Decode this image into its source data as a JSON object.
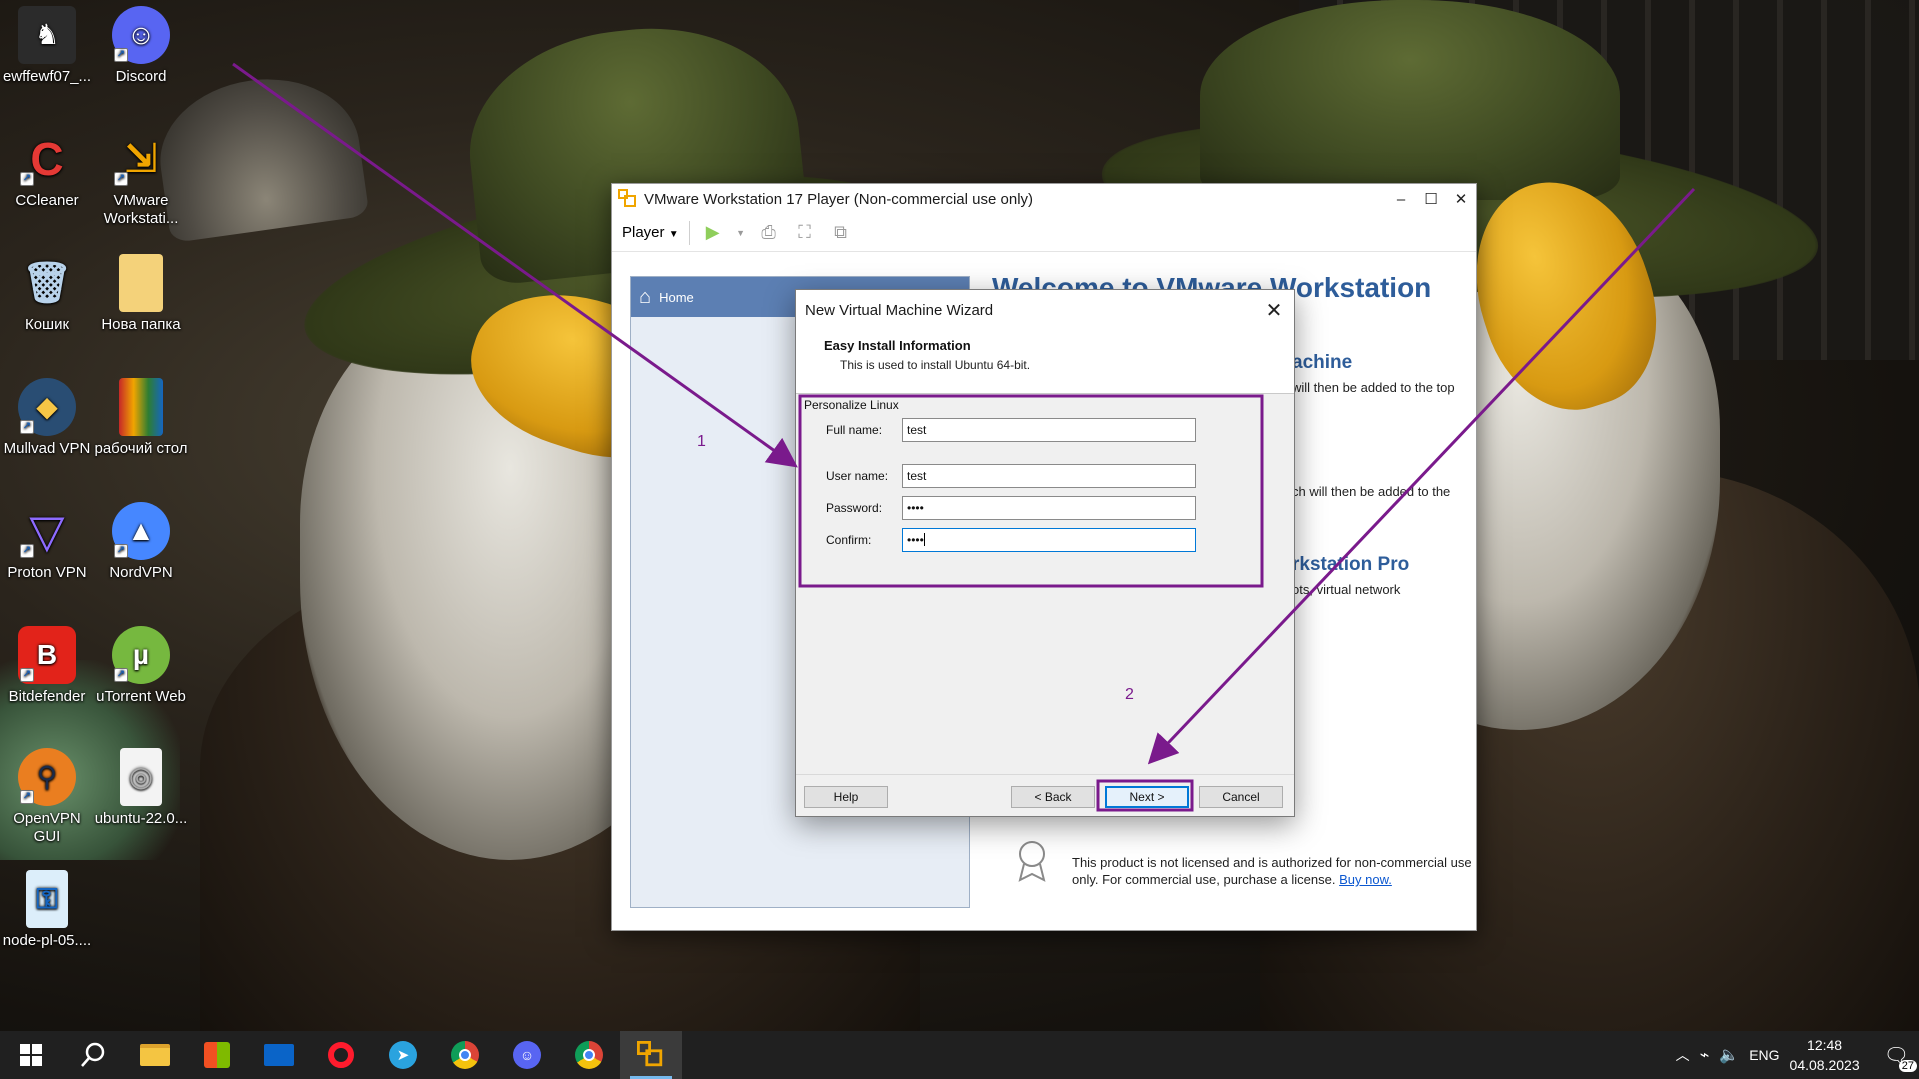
{
  "desktop": {
    "icons": [
      {
        "label": "ewffewf07_...",
        "color": "#2b2b2b"
      },
      {
        "label": "Discord",
        "color": "#5865f2"
      },
      {
        "label": "CCleaner",
        "color": "#c62828"
      },
      {
        "label": "VMware Workstati...",
        "color": "#f0a500"
      },
      {
        "label": "Кошик",
        "color": "#7ba7c9"
      },
      {
        "label": "Нова папка",
        "color": "#f4d27a"
      },
      {
        "label": "Mullvad VPN",
        "color": "#294d73"
      },
      {
        "label": "рабочий стол",
        "color": "#d98c2b"
      },
      {
        "label": "Proton VPN",
        "color": "#6d4aff"
      },
      {
        "label": "NordVPN",
        "color": "#4687ff"
      },
      {
        "label": "Bitdefender",
        "color": "#e2231a"
      },
      {
        "label": "uTorrent Web",
        "color": "#76b83f"
      },
      {
        "label": "OpenVPN GUI",
        "color": "#ea7e20"
      },
      {
        "label": "ubuntu-22.0...",
        "color": "#e8e8e8"
      },
      {
        "label": "node-pl-05....",
        "color": "#6fb5e8"
      }
    ]
  },
  "vmware": {
    "title": "VMware Workstation 17 Player (Non-commercial use only)",
    "menu_player": "Player",
    "sidebar_home": "Home",
    "home": {
      "title_visible": "Welcome to VMware Workstation",
      "h2_a": "achine",
      "text_a": "will then be added to the top",
      "text_b": "ch will then be added to the",
      "h2_b": "rkstation Pro",
      "text_c": "ots, virtual network",
      "license_text": "This product is not licensed and is authorized for non-commercial use only. For commercial use, purchase a license.",
      "license_link": "Buy now."
    }
  },
  "wizard": {
    "title": "New Virtual Machine Wizard",
    "header_title": "Easy Install Information",
    "header_subtitle": "This is used to install Ubuntu 64-bit.",
    "group_label": "Personalize Linux",
    "fields": {
      "full_name_label": "Full name:",
      "full_name_value": "test",
      "user_name_label": "User name:",
      "user_name_value": "test",
      "password_label": "Password:",
      "password_value": "••••",
      "confirm_label": "Confirm:",
      "confirm_value": "••••"
    },
    "buttons": {
      "help": "Help",
      "back": "< Back",
      "next": "Next >",
      "cancel": "Cancel"
    }
  },
  "annotations": {
    "label_1": "1",
    "label_2": "2",
    "color": "#7a1a8c"
  },
  "taskbar": {
    "language": "ENG",
    "time": "12:48",
    "date": "04.08.2023",
    "notifications": "27"
  }
}
